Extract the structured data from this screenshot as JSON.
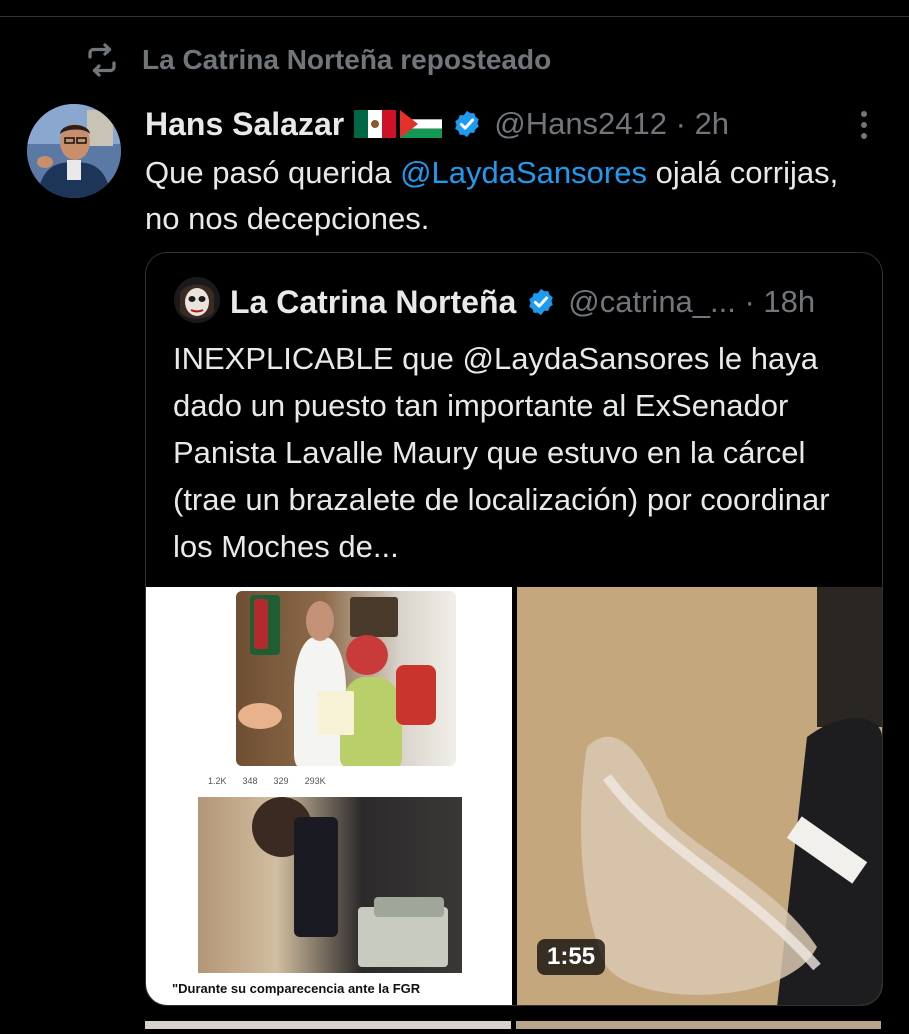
{
  "repost": {
    "label": "La Catrina Norteña reposteado"
  },
  "tweet": {
    "author_name": "Hans Salazar",
    "flags": [
      "🇲🇽",
      "🇵🇸"
    ],
    "handle_line": "@Hans2412 · 2h",
    "text_before": "Que pasó querida ",
    "mention": "@LaydaSansores",
    "text_after": " ojalá corrijas, no nos decepciones."
  },
  "quote": {
    "author_name": "La Catrina Norteña",
    "handle_line": "@catrina_... · 18h",
    "text": "INEXPLICABLE que @LaydaSansores le haya dado un puesto tan importante al ExSenador Panista Lavalle Maury que estuvo en la cárcel (trae un brazalete de localización) por coordinar los Moches de...",
    "media": {
      "image_stats": [
        "1.2K",
        "348",
        "329",
        "293K"
      ],
      "image_caption": "\"Durante su comparecencia ante la FGR",
      "video_duration": "1:55"
    }
  },
  "colors": {
    "background": "#000000",
    "text": "#e7e9ea",
    "muted": "#71767b",
    "accent": "#1d9bf0",
    "border": "#2f3336"
  },
  "icons": {
    "repost": "repost-icon",
    "verified": "verified-badge-icon",
    "more": "more-vertical-icon"
  }
}
